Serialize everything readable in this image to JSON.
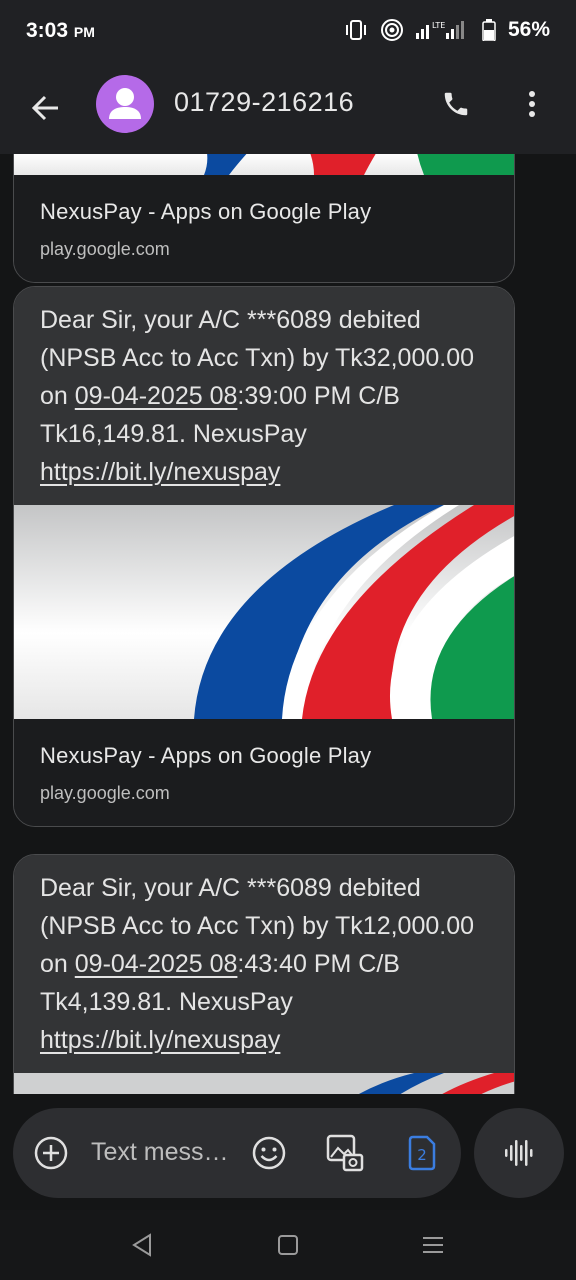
{
  "status_bar": {
    "time": "3:03",
    "ampm": "PM",
    "battery": "56%",
    "icons": [
      "vibrate-icon",
      "hotspot-icon",
      "signal-lte-icon",
      "battery-icon"
    ]
  },
  "app_bar": {
    "contact": "01729-216216",
    "icons": [
      "back-arrow-icon",
      "avatar-icon",
      "phone-icon",
      "more-vert-icon"
    ]
  },
  "messages": [
    {
      "type": "link_preview_partial",
      "preview_title": "NexusPay - Apps on Google Play",
      "preview_domain": "play.google.com"
    },
    {
      "type": "sms",
      "text_before": "Dear Sir, your A/C ***6089 debited (NPSB Acc to Acc Txn) by Tk32,000.00 on ",
      "date_link": "09-04-2025 08",
      "text_after": ":39:00 PM C/B Tk16,149.81. NexusPay ",
      "url": "https://bit.ly/nexuspay",
      "preview_title": "NexusPay - Apps on Google Play",
      "preview_domain": "play.google.com"
    },
    {
      "type": "sms",
      "text_before": "Dear Sir, your A/C ***6089 debited (NPSB Acc to Acc Txn) by Tk12,000.00 on ",
      "date_link": "09-04-2025 08",
      "text_after": ":43:40 PM C/B Tk4,139.81. NexusPay ",
      "url": "https://bit.ly/nexuspay"
    }
  ],
  "compose": {
    "placeholder": "Text mess…",
    "sim_number": "2",
    "icons": [
      "add-circle-icon",
      "emoji-icon",
      "gallery-icon",
      "sim-card-icon",
      "voice-waveform-icon"
    ]
  },
  "nav_bar": {
    "icons": [
      "back-triangle-icon",
      "home-square-icon",
      "recents-menu-icon"
    ]
  },
  "colors": {
    "bubble": "#333436",
    "avatar": "#b56ae8",
    "sim_accent": "#3b7de0",
    "brand_blue": "#0b4aa0",
    "brand_red": "#e0202a",
    "brand_green": "#0f9a4e"
  }
}
